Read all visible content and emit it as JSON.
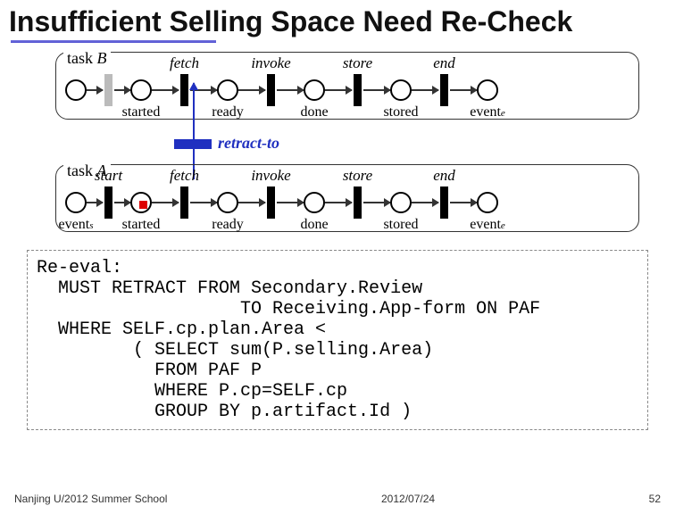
{
  "title": "Insufficient Selling Space Need Re-Check",
  "tasks": {
    "b": {
      "label_prefix": "task ",
      "label_letter": "B",
      "steps": [
        {
          "above": "",
          "below": ""
        },
        {
          "above": "",
          "below": "started"
        },
        {
          "above": "fetch",
          "below": "ready"
        },
        {
          "above": "invoke",
          "below": "done"
        },
        {
          "above": "store",
          "below": "stored"
        },
        {
          "above": "end",
          "below_prefix": "event",
          "below_sub": "e"
        }
      ]
    },
    "a": {
      "label_prefix": "task ",
      "label_letter": "A",
      "start_above": "start",
      "steps": [
        {
          "above": "",
          "below_prefix": "event",
          "below_sub": "s"
        },
        {
          "above": "",
          "below": "started",
          "reddot": true
        },
        {
          "above": "fetch",
          "below": "ready"
        },
        {
          "above": "invoke",
          "below": "done"
        },
        {
          "above": "store",
          "below": "stored"
        },
        {
          "above": "end",
          "below_prefix": "event",
          "below_sub": "e"
        }
      ]
    }
  },
  "retract_label": "retract-to",
  "code": "Re-eval:\n  MUST RETRACT FROM Secondary.Review\n                   TO Receiving.App-form ON PAF\n  WHERE SELF.cp.plan.Area <\n         ( SELECT sum(P.selling.Area)\n           FROM PAF P\n           WHERE P.cp=SELF.cp\n           GROUP BY p.artifact.Id )",
  "footer": {
    "left": "Nanjing U/2012 Summer School",
    "center": "2012/07/24",
    "right": "52"
  }
}
